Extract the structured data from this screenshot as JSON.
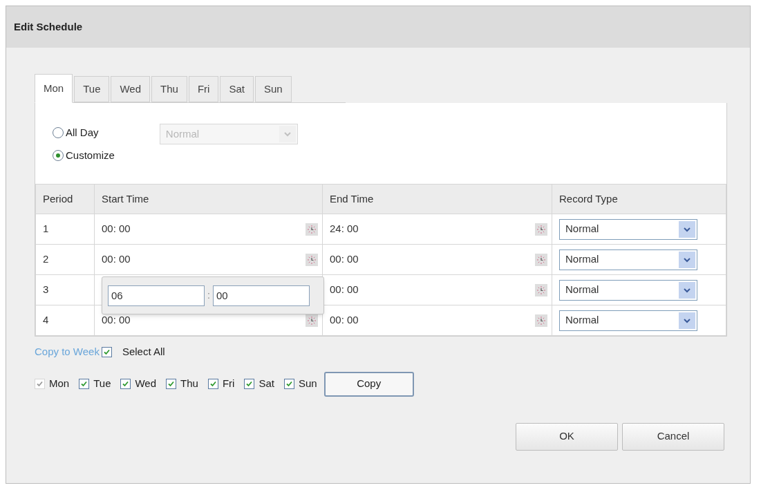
{
  "window": {
    "title": "Edit Schedule"
  },
  "tabs": [
    {
      "label": "Mon",
      "selected": true
    },
    {
      "label": "Tue",
      "selected": false
    },
    {
      "label": "Wed",
      "selected": false
    },
    {
      "label": "Thu",
      "selected": false
    },
    {
      "label": "Fri",
      "selected": false
    },
    {
      "label": "Sat",
      "selected": false
    },
    {
      "label": "Sun",
      "selected": false
    }
  ],
  "mode": [
    {
      "label": "All Day",
      "selected": false
    },
    {
      "label": "Customize",
      "selected": true
    }
  ],
  "all_day_select": {
    "value": "Normal",
    "disabled": true
  },
  "table": {
    "columns": [
      "Period",
      "Start Time",
      "End Time",
      "Record Type"
    ],
    "rows": [
      {
        "period": "1",
        "start": "00: 00",
        "end": "24: 00",
        "record_type": "Normal",
        "picker_open": false
      },
      {
        "period": "2",
        "start": "00: 00",
        "end": "00: 00",
        "record_type": "Normal",
        "picker_open": false
      },
      {
        "period": "3",
        "end": "00: 00",
        "record_type": "Normal",
        "picker_open": true
      },
      {
        "period": "4",
        "start": "00: 00",
        "end": "00: 00",
        "record_type": "Normal",
        "picker_open": false
      }
    ]
  },
  "time_popup": {
    "hour": "06",
    "separator": ":",
    "minute": "00"
  },
  "copy_to_week": {
    "link": "Copy to Week",
    "select_all": {
      "label": "Select All",
      "checked": true
    },
    "days": [
      {
        "label": "Mon",
        "checked": true,
        "disabled": true
      },
      {
        "label": "Tue",
        "checked": true,
        "disabled": false
      },
      {
        "label": "Wed",
        "checked": true,
        "disabled": false
      },
      {
        "label": "Thu",
        "checked": true,
        "disabled": false
      },
      {
        "label": "Fri",
        "checked": true,
        "disabled": false
      },
      {
        "label": "Sat",
        "checked": true,
        "disabled": false
      },
      {
        "label": "Sun",
        "checked": true,
        "disabled": false
      }
    ],
    "button": "Copy"
  },
  "buttons": [
    "OK",
    "Cancel"
  ]
}
